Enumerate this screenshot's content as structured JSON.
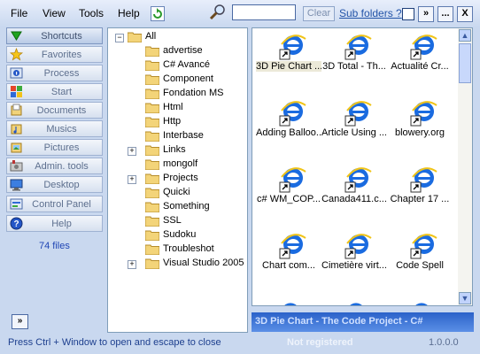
{
  "menu": {
    "items": [
      "File",
      "View",
      "Tools",
      "Help"
    ]
  },
  "toolbar": {
    "search_value": "",
    "clear_label": "Clear",
    "subfolders_label": "Sub folders ?",
    "collapse_glyph": "»",
    "more_label": "...",
    "close_label": "X"
  },
  "sidebar": {
    "items": [
      {
        "label": "Shortcuts",
        "icon": "green-down-triangle-icon"
      },
      {
        "label": "Favorites",
        "icon": "star-icon"
      },
      {
        "label": "Process",
        "icon": "process-info-icon"
      },
      {
        "label": "Start",
        "icon": "start-icon"
      },
      {
        "label": "Documents",
        "icon": "documents-icon"
      },
      {
        "label": "Musics",
        "icon": "music-icon"
      },
      {
        "label": "Pictures",
        "icon": "pictures-icon"
      },
      {
        "label": "Admin. tools",
        "icon": "admin-tools-icon"
      },
      {
        "label": "Desktop",
        "icon": "desktop-icon"
      },
      {
        "label": "Control Panel",
        "icon": "control-panel-icon"
      },
      {
        "label": "Help",
        "icon": "help-icon"
      }
    ],
    "file_count": "74 files",
    "expand_glyph": "»"
  },
  "tree": {
    "root": {
      "label": "All",
      "toggle": "−"
    },
    "items": [
      {
        "label": "advertise",
        "toggle": ""
      },
      {
        "label": "C# Avancé",
        "toggle": ""
      },
      {
        "label": "Component",
        "toggle": ""
      },
      {
        "label": "Fondation MS",
        "toggle": ""
      },
      {
        "label": "Html",
        "toggle": ""
      },
      {
        "label": "Http",
        "toggle": ""
      },
      {
        "label": "Interbase",
        "toggle": ""
      },
      {
        "label": "Links",
        "toggle": "+"
      },
      {
        "label": "mongolf",
        "toggle": ""
      },
      {
        "label": "Projects",
        "toggle": "+"
      },
      {
        "label": "Quicki",
        "toggle": ""
      },
      {
        "label": "Something",
        "toggle": ""
      },
      {
        "label": "SSL",
        "toggle": ""
      },
      {
        "label": "Sudoku",
        "toggle": ""
      },
      {
        "label": "Troubleshot",
        "toggle": ""
      },
      {
        "label": "Visual Studio 2005",
        "toggle": "+"
      }
    ]
  },
  "files": {
    "items": [
      {
        "label": "3D Pie Chart ...",
        "selected": true
      },
      {
        "label": "3D Total - Th...",
        "selected": false
      },
      {
        "label": "Actualité  Cr...",
        "selected": false
      },
      {
        "label": "Adding Balloo...",
        "selected": false
      },
      {
        "label": "Article Using ...",
        "selected": false
      },
      {
        "label": "blowery.org",
        "selected": false
      },
      {
        "label": "c# WM_COP...",
        "selected": false
      },
      {
        "label": "Canada411.c...",
        "selected": false
      },
      {
        "label": "Chapter 17 ...",
        "selected": false
      },
      {
        "label": "Chart com...",
        "selected": false
      },
      {
        "label": "Cimetière virt...",
        "selected": false
      },
      {
        "label": "Code Spell",
        "selected": false
      }
    ],
    "scroll_up_glyph": "▲",
    "scroll_down_glyph": "▼"
  },
  "preview": {
    "title": "3D Pie Chart - The Code Project - C#"
  },
  "status": {
    "hint": "Press Ctrl + Window to open and escape to close",
    "registration": "Not registered",
    "version": "1.0.0.0"
  },
  "colors": {
    "accent": "#2b62c9",
    "link": "#2354a8",
    "window_bg": "#c9d8ef",
    "file_count": "#1f45b4",
    "status_text": "#1d3f8e"
  }
}
